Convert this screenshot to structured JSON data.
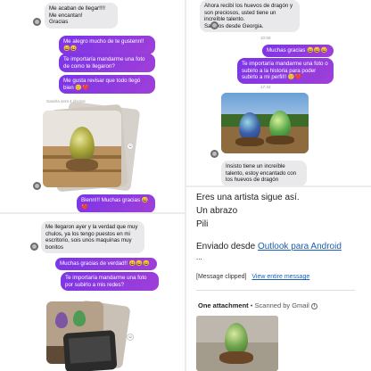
{
  "top_left": {
    "msg1": "Me acaban de llegar!!!!\nMe encantan!\nGracias",
    "msg2": "Me alegro mucho de te gustenn!! 😄😄",
    "msg3": "Te importaría mandarme una foto de como te llegaron?",
    "msg4": "Me gusta revisar que todo llegó bien 🙂❤️",
    "photos_meta": "Sandra sent 4 photos",
    "msg5": "Bienn!!! Muchas gracias 😄❤️"
  },
  "top_right": {
    "msg1": "Ahora recibí los huevos de dragón y son preciosos, usted tiene un increíble talento.\nSaludos desde Georgia.",
    "time1": "10:56",
    "msg2": "Muchas gracias 😄😄😄",
    "msg3": "Te importaría mandarme una foto o subirlo a la historia para poder subirlo a mi perfil!! 🙂❤️",
    "time2": "17:42",
    "msg4": "Insisto tiene un increíble talento, estoy encantado con los huevos de dragón"
  },
  "bottom_left": {
    "msg1": "Me llegaron ayer y la verdad que muy chulos, ya los tengo puestos en mi escritorio, sois unos maquinas muy bonitos",
    "msg2": "Muchas gracias de verdad!! 😄😄😄",
    "msg3": "Te importaría mandarme una foto por subirlo a mis redes?"
  },
  "bottom_right": {
    "line1": "Eres una artista sigue así.",
    "line2": "Un abrazo",
    "line3": "Pili",
    "sent_prefix": "Enviado desde ",
    "sent_link": "Outlook para Android",
    "dots": "...",
    "clipped": "[Message clipped]",
    "view_link": "View entire message",
    "attach_title": "One attachment",
    "attach_dot": "•",
    "attach_scan": "Scanned by Gmail",
    "info": "i"
  },
  "colors": {
    "outgoing_bubble": "#8a2be2",
    "incoming_bubble": "#e9e9eb",
    "link": "#1a5fb4"
  }
}
